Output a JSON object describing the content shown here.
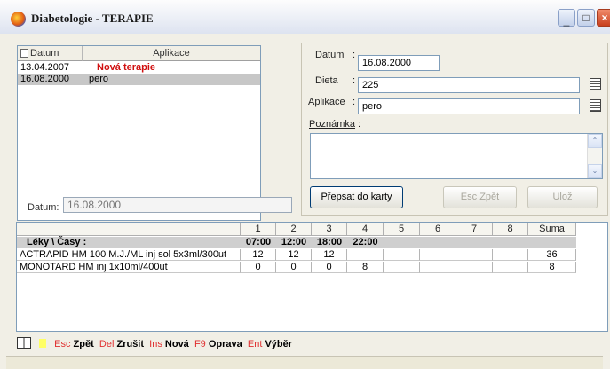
{
  "window": {
    "title": "Diabetologie - TERAPIE",
    "min_glyph": "_",
    "max_glyph": "□",
    "close_glyph": "×"
  },
  "list": {
    "columns": [
      "Datum",
      "Aplikace"
    ],
    "rows": [
      {
        "date": "13.04.2007",
        "app": "Nová terapie",
        "selected": false,
        "highlight": true
      },
      {
        "date": "16.08.2000",
        "app": "pero",
        "selected": true,
        "highlight": false
      }
    ],
    "datum_label": "Datum:",
    "datum_value": "16.08.2000"
  },
  "form": {
    "datum_label": "Datum",
    "datum_value": "16.08.2000",
    "dieta_label": "Dieta",
    "dieta_value": "225",
    "aplikace_label": "Aplikace",
    "aplikace_value": "pero",
    "poznamka_label": "Poznámka",
    "poznamka_value": "",
    "colon": ":",
    "btn_prepsat": "Přepsat do karty",
    "btn_zpet": "Esc Zpět",
    "btn_uloz": "Ulož",
    "scroll_up": "⌃",
    "scroll_down": "⌄"
  },
  "grid": {
    "headers": [
      "",
      "1",
      "2",
      "3",
      "4",
      "5",
      "6",
      "7",
      "8",
      "Suma"
    ],
    "subheader": {
      "label": "Léky \\ Časy :",
      "times": [
        "07:00",
        "12:00",
        "18:00",
        "22:00"
      ]
    },
    "rows": [
      {
        "name": "ACTRAPID HM 100 M.J./ML inj sol 5x3ml/300ut",
        "doses": [
          "12",
          "12",
          "12",
          "",
          "",
          "",
          "",
          ""
        ],
        "sum": "36"
      },
      {
        "name": "MONOTARD HM inj 1x10ml/400ut",
        "doses": [
          "0",
          "0",
          "0",
          "8",
          "",
          "",
          "",
          ""
        ],
        "sum": "8"
      }
    ]
  },
  "toolbar": {
    "items": [
      {
        "key": "Esc",
        "label": "Zpět"
      },
      {
        "key": "Del",
        "label": "Zrušit"
      },
      {
        "key": "Ins",
        "label": "Nová"
      },
      {
        "key": "F9",
        "label": "Oprava"
      },
      {
        "key": "Ent",
        "label": "Výběr"
      }
    ]
  },
  "colors": {
    "accent_red": "#d01010",
    "selection": "#c7c7c7",
    "border_blue": "#7f9db9"
  }
}
